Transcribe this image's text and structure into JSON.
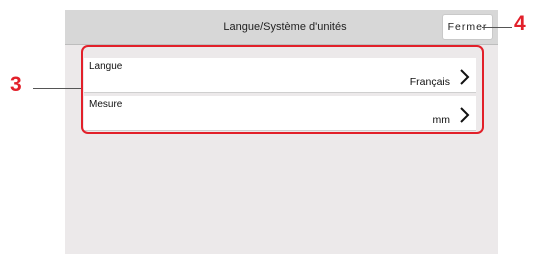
{
  "header": {
    "title": "Langue/Système d'unités"
  },
  "close_button": {
    "label": "Fermer"
  },
  "settings": [
    {
      "label": "Langue",
      "value": "Français",
      "icon": "chevron-right-icon"
    },
    {
      "label": "Mesure",
      "value": "mm",
      "icon": "chevron-right-icon"
    }
  ],
  "callouts": {
    "list": "3",
    "close": "4",
    "color": "#e2202a"
  }
}
